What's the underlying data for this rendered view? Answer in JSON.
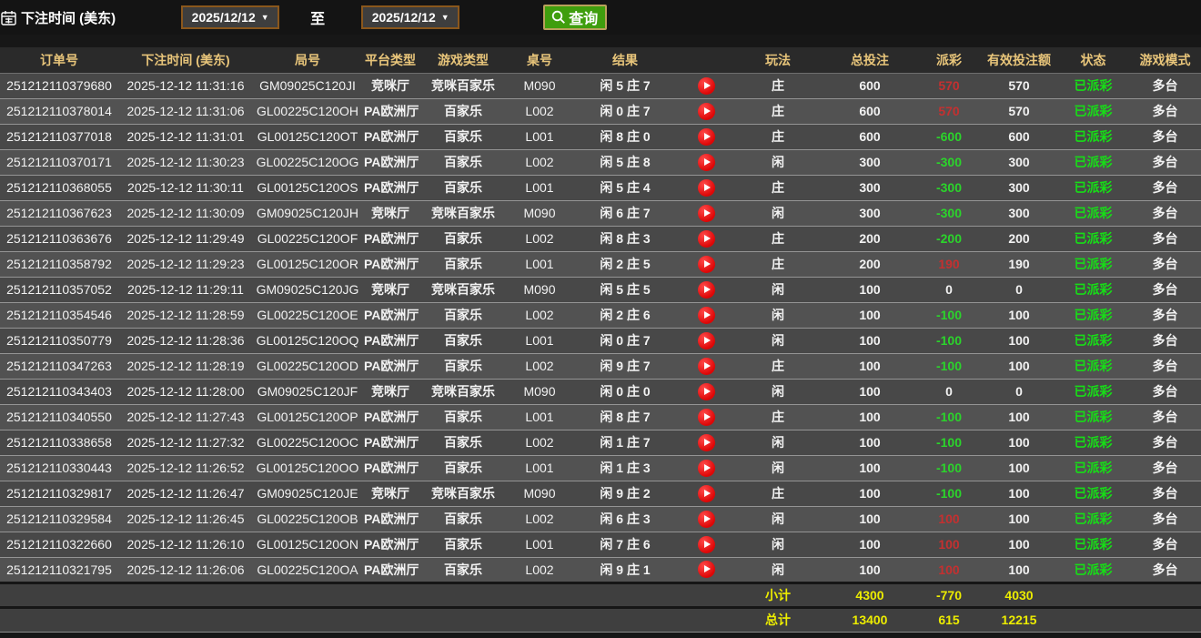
{
  "topbar": {
    "label": "下注时间 (美东)",
    "date_from": "2025/12/12",
    "to_label": "至",
    "date_to": "2025/12/12",
    "query_label": "查询"
  },
  "colors": {
    "header_gold": "#e8c57a",
    "payout_positive_red": "#c43030",
    "payout_negative_green": "#2bd42b",
    "status_green": "#17dd17",
    "summary_yellow": "#ecec00",
    "query_button_green": "#3f9e0d",
    "date_dropdown_border": "#8a571c",
    "play_icon_red": "#dd0606"
  },
  "table": {
    "headers": [
      "订单号",
      "下注时间 (美东)",
      "局号",
      "平台类型",
      "游戏类型",
      "桌号",
      "结果",
      "",
      "玩法",
      "总投注",
      "派彩",
      "有效投注额",
      "状态",
      "游戏模式"
    ],
    "rows": [
      {
        "order": "251212110379680",
        "time": "2025-12-12 11:31:16",
        "round": "GM09025C120JI",
        "platform": "竞咪厅",
        "game": "竞咪百家乐",
        "table": "M090",
        "result": "闲 5 庄 7",
        "play": "庄",
        "bet": "600",
        "payout": "570",
        "payout_color": "red",
        "valid": "570",
        "status": "已派彩",
        "mode": "多台"
      },
      {
        "order": "251212110378014",
        "time": "2025-12-12 11:31:06",
        "round": "GL00225C120OH",
        "platform": "PA欧洲厅",
        "game": "百家乐",
        "table": "L002",
        "result": "闲 0 庄 7",
        "play": "庄",
        "bet": "600",
        "payout": "570",
        "payout_color": "red",
        "valid": "570",
        "status": "已派彩",
        "mode": "多台"
      },
      {
        "order": "251212110377018",
        "time": "2025-12-12 11:31:01",
        "round": "GL00125C120OT",
        "platform": "PA欧洲厅",
        "game": "百家乐",
        "table": "L001",
        "result": "闲 8 庄 0",
        "play": "庄",
        "bet": "600",
        "payout": "-600",
        "payout_color": "green",
        "valid": "600",
        "status": "已派彩",
        "mode": "多台"
      },
      {
        "order": "251212110370171",
        "time": "2025-12-12 11:30:23",
        "round": "GL00225C120OG",
        "platform": "PA欧洲厅",
        "game": "百家乐",
        "table": "L002",
        "result": "闲 5 庄 8",
        "play": "闲",
        "bet": "300",
        "payout": "-300",
        "payout_color": "green",
        "valid": "300",
        "status": "已派彩",
        "mode": "多台"
      },
      {
        "order": "251212110368055",
        "time": "2025-12-12 11:30:11",
        "round": "GL00125C120OS",
        "platform": "PA欧洲厅",
        "game": "百家乐",
        "table": "L001",
        "result": "闲 5 庄 4",
        "play": "庄",
        "bet": "300",
        "payout": "-300",
        "payout_color": "green",
        "valid": "300",
        "status": "已派彩",
        "mode": "多台"
      },
      {
        "order": "251212110367623",
        "time": "2025-12-12 11:30:09",
        "round": "GM09025C120JH",
        "platform": "竞咪厅",
        "game": "竞咪百家乐",
        "table": "M090",
        "result": "闲 6 庄 7",
        "play": "闲",
        "bet": "300",
        "payout": "-300",
        "payout_color": "green",
        "valid": "300",
        "status": "已派彩",
        "mode": "多台"
      },
      {
        "order": "251212110363676",
        "time": "2025-12-12 11:29:49",
        "round": "GL00225C120OF",
        "platform": "PA欧洲厅",
        "game": "百家乐",
        "table": "L002",
        "result": "闲 8 庄 3",
        "play": "庄",
        "bet": "200",
        "payout": "-200",
        "payout_color": "green",
        "valid": "200",
        "status": "已派彩",
        "mode": "多台"
      },
      {
        "order": "251212110358792",
        "time": "2025-12-12 11:29:23",
        "round": "GL00125C120OR",
        "platform": "PA欧洲厅",
        "game": "百家乐",
        "table": "L001",
        "result": "闲 2 庄 5",
        "play": "庄",
        "bet": "200",
        "payout": "190",
        "payout_color": "red",
        "valid": "190",
        "status": "已派彩",
        "mode": "多台"
      },
      {
        "order": "251212110357052",
        "time": "2025-12-12 11:29:11",
        "round": "GM09025C120JG",
        "platform": "竞咪厅",
        "game": "竞咪百家乐",
        "table": "M090",
        "result": "闲 5 庄 5",
        "play": "闲",
        "bet": "100",
        "payout": "0",
        "payout_color": "white",
        "valid": "0",
        "status": "已派彩",
        "mode": "多台"
      },
      {
        "order": "251212110354546",
        "time": "2025-12-12 11:28:59",
        "round": "GL00225C120OE",
        "platform": "PA欧洲厅",
        "game": "百家乐",
        "table": "L002",
        "result": "闲 2 庄 6",
        "play": "闲",
        "bet": "100",
        "payout": "-100",
        "payout_color": "green",
        "valid": "100",
        "status": "已派彩",
        "mode": "多台"
      },
      {
        "order": "251212110350779",
        "time": "2025-12-12 11:28:36",
        "round": "GL00125C120OQ",
        "platform": "PA欧洲厅",
        "game": "百家乐",
        "table": "L001",
        "result": "闲 0 庄 7",
        "play": "闲",
        "bet": "100",
        "payout": "-100",
        "payout_color": "green",
        "valid": "100",
        "status": "已派彩",
        "mode": "多台"
      },
      {
        "order": "251212110347263",
        "time": "2025-12-12 11:28:19",
        "round": "GL00225C120OD",
        "platform": "PA欧洲厅",
        "game": "百家乐",
        "table": "L002",
        "result": "闲 9 庄 7",
        "play": "庄",
        "bet": "100",
        "payout": "-100",
        "payout_color": "green",
        "valid": "100",
        "status": "已派彩",
        "mode": "多台"
      },
      {
        "order": "251212110343403",
        "time": "2025-12-12 11:28:00",
        "round": "GM09025C120JF",
        "platform": "竞咪厅",
        "game": "竞咪百家乐",
        "table": "M090",
        "result": "闲 0 庄 0",
        "play": "闲",
        "bet": "100",
        "payout": "0",
        "payout_color": "white",
        "valid": "0",
        "status": "已派彩",
        "mode": "多台"
      },
      {
        "order": "251212110340550",
        "time": "2025-12-12 11:27:43",
        "round": "GL00125C120OP",
        "platform": "PA欧洲厅",
        "game": "百家乐",
        "table": "L001",
        "result": "闲 8 庄 7",
        "play": "庄",
        "bet": "100",
        "payout": "-100",
        "payout_color": "green",
        "valid": "100",
        "status": "已派彩",
        "mode": "多台"
      },
      {
        "order": "251212110338658",
        "time": "2025-12-12 11:27:32",
        "round": "GL00225C120OC",
        "platform": "PA欧洲厅",
        "game": "百家乐",
        "table": "L002",
        "result": "闲 1 庄 7",
        "play": "闲",
        "bet": "100",
        "payout": "-100",
        "payout_color": "green",
        "valid": "100",
        "status": "已派彩",
        "mode": "多台"
      },
      {
        "order": "251212110330443",
        "time": "2025-12-12 11:26:52",
        "round": "GL00125C120OO",
        "platform": "PA欧洲厅",
        "game": "百家乐",
        "table": "L001",
        "result": "闲 1 庄 3",
        "play": "闲",
        "bet": "100",
        "payout": "-100",
        "payout_color": "green",
        "valid": "100",
        "status": "已派彩",
        "mode": "多台"
      },
      {
        "order": "251212110329817",
        "time": "2025-12-12 11:26:47",
        "round": "GM09025C120JE",
        "platform": "竞咪厅",
        "game": "竞咪百家乐",
        "table": "M090",
        "result": "闲 9 庄 2",
        "play": "庄",
        "bet": "100",
        "payout": "-100",
        "payout_color": "green",
        "valid": "100",
        "status": "已派彩",
        "mode": "多台"
      },
      {
        "order": "251212110329584",
        "time": "2025-12-12 11:26:45",
        "round": "GL00225C120OB",
        "platform": "PA欧洲厅",
        "game": "百家乐",
        "table": "L002",
        "result": "闲 6 庄 3",
        "play": "闲",
        "bet": "100",
        "payout": "100",
        "payout_color": "red",
        "valid": "100",
        "status": "已派彩",
        "mode": "多台"
      },
      {
        "order": "251212110322660",
        "time": "2025-12-12 11:26:10",
        "round": "GL00125C120ON",
        "platform": "PA欧洲厅",
        "game": "百家乐",
        "table": "L001",
        "result": "闲 7 庄 6",
        "play": "闲",
        "bet": "100",
        "payout": "100",
        "payout_color": "red",
        "valid": "100",
        "status": "已派彩",
        "mode": "多台"
      },
      {
        "order": "251212110321795",
        "time": "2025-12-12 11:26:06",
        "round": "GL00225C120OA",
        "platform": "PA欧洲厅",
        "game": "百家乐",
        "table": "L002",
        "result": "闲 9 庄 1",
        "play": "闲",
        "bet": "100",
        "payout": "100",
        "payout_color": "red",
        "valid": "100",
        "status": "已派彩",
        "mode": "多台"
      }
    ],
    "footer": [
      {
        "label": "小计",
        "bet": "4300",
        "payout": "-770",
        "valid": "4030"
      },
      {
        "label": "总计",
        "bet": "13400",
        "payout": "615",
        "valid": "12215"
      }
    ]
  }
}
